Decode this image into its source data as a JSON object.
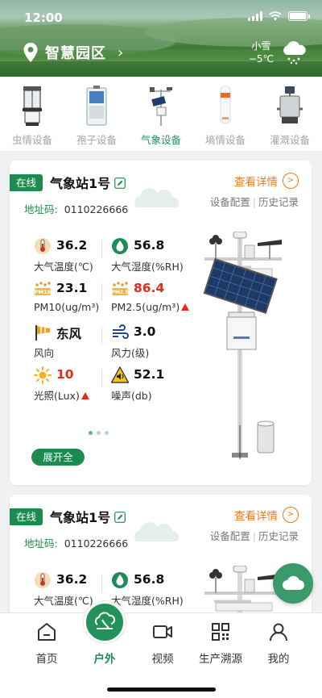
{
  "status_bar": {
    "time": "12:00"
  },
  "header": {
    "location_name": "智慧园区",
    "weather_condition": "小雪",
    "weather_temp": "−5℃",
    "weather_icon": "snow-cloud-icon"
  },
  "device_tabs": [
    {
      "label": "虫情设备",
      "icon": "insect-trap-icon",
      "active": false
    },
    {
      "label": "孢子设备",
      "icon": "spore-trap-icon",
      "active": false
    },
    {
      "label": "气象设备",
      "icon": "weather-station-icon",
      "active": true
    },
    {
      "label": "墒情设备",
      "icon": "soil-sensor-icon",
      "active": false
    },
    {
      "label": "灌溉设备",
      "icon": "irrigation-icon",
      "active": false
    }
  ],
  "cards": [
    {
      "status": "在线",
      "name": "气象站1号",
      "detail_link": "查看详情",
      "config_link": "设备配置",
      "history_link": "历史记录",
      "address_label": "地址码:",
      "address_value": "0110226666",
      "metrics": [
        {
          "value": "36.2",
          "label": "大气温度(℃)",
          "icon": "thermometer-icon",
          "alert": false
        },
        {
          "value": "56.8",
          "label": "大气湿度(%RH)",
          "icon": "humidity-drop-icon",
          "alert": false
        },
        {
          "value": "23.1",
          "label": "PM10(ug/m³)",
          "icon": "pm10-icon",
          "alert": false
        },
        {
          "value": "86.4",
          "label": "PM2.5(ug/m³)",
          "icon": "pm25-icon",
          "alert": true
        },
        {
          "value": "东风",
          "label": "风向",
          "icon": "wind-vane-icon",
          "alert": false
        },
        {
          "value": "3.0",
          "label": "风力(级)",
          "icon": "wind-icon",
          "alert": false
        },
        {
          "value": "10",
          "label": "光照(Lux)",
          "icon": "sun-icon",
          "alert": true
        },
        {
          "value": "52.1",
          "label": "噪声(db)",
          "icon": "noise-icon",
          "alert": false
        }
      ],
      "expand_button": "展开全"
    },
    {
      "status": "在线",
      "name": "气象站1号",
      "detail_link": "查看详情",
      "config_link": "设备配置",
      "history_link": "历史记录",
      "address_label": "地址码:",
      "address_value": "0110226666",
      "metrics": [
        {
          "value": "36.2",
          "label": "大气温度(℃)",
          "icon": "thermometer-icon",
          "alert": false
        },
        {
          "value": "56.8",
          "label": "大气湿度(%RH)",
          "icon": "humidity-drop-icon",
          "alert": false
        }
      ]
    }
  ],
  "bottom_nav": [
    {
      "label": "首页",
      "icon": "home-icon",
      "active": false
    },
    {
      "label": "户外",
      "icon": "outdoor-icon",
      "active": true
    },
    {
      "label": "视频",
      "icon": "video-icon",
      "active": false
    },
    {
      "label": "生产溯源",
      "icon": "qr-code-icon",
      "active": false
    },
    {
      "label": "我的",
      "icon": "user-icon",
      "active": false
    }
  ],
  "colors": {
    "brand_green": "#1e8a4f",
    "link_orange": "#ee7a18",
    "alert_red": "#e42a1c"
  }
}
